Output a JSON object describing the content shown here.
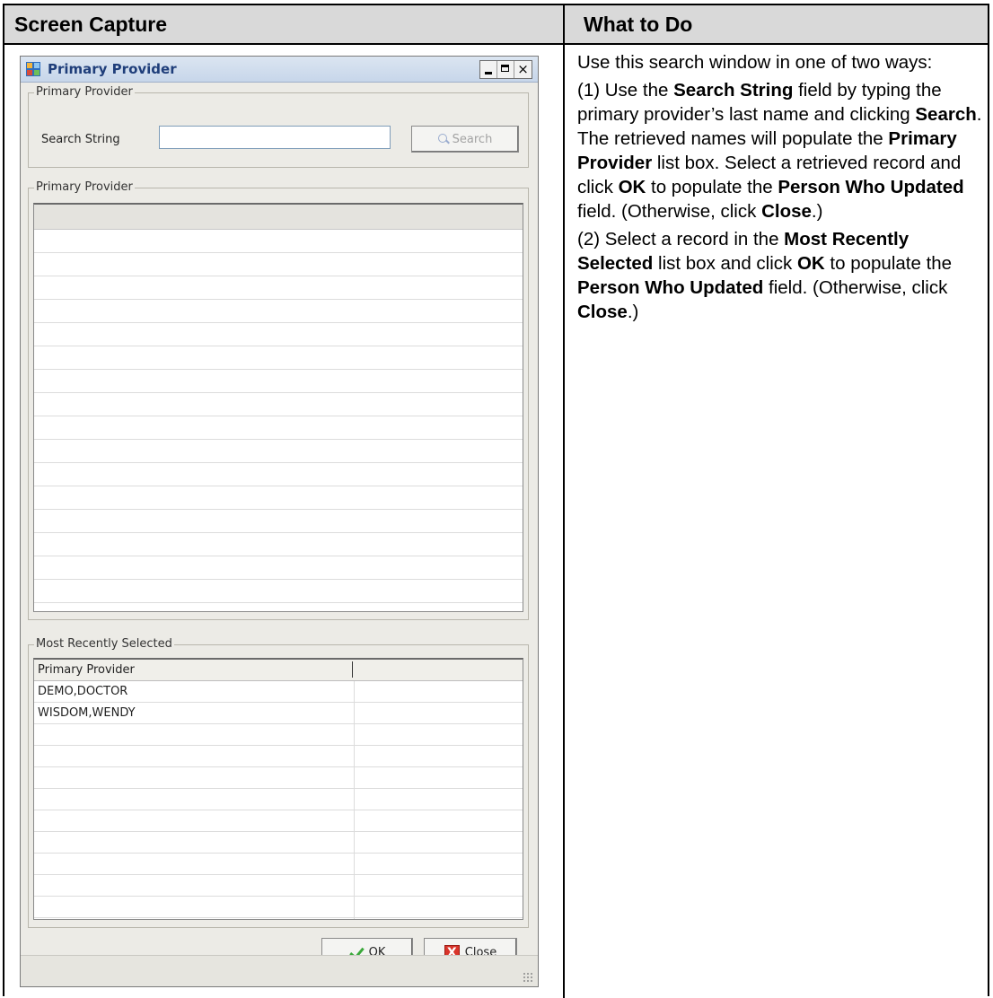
{
  "table": {
    "header_left": "Screen Capture",
    "header_right": "What to Do"
  },
  "dialog": {
    "title": "Primary Provider",
    "group_search_label": "Primary Provider",
    "search_label": "Search String",
    "search_value": "",
    "search_button": "Search",
    "group_results_label": "Primary Provider",
    "group_recent_label": "Most Recently Selected",
    "recent_column_header": "Primary Provider",
    "recent_rows": [
      "DEMO,DOCTOR",
      "WISDOM,WENDY"
    ],
    "ok_label": "OK",
    "close_label": "Close",
    "close_button_glyph": "×",
    "close_icon_glyph": "X"
  },
  "instructions": {
    "p1": "Use this search window in one of two ways:",
    "p2": {
      "t1": "(1) Use the ",
      "b1": "Search String",
      "t2": " field by typing the primary provider’s last name and clicking ",
      "b2": "Search",
      "t3": ". The retrieved names will populate the ",
      "b3": "Primary Provider",
      "t4": " list box. Select a retrieved record and click ",
      "b4": "OK",
      "t5": " to populate the ",
      "b5": "Person Who Updated",
      "t6": " field. (Otherwise, click ",
      "b6": "Close",
      "t7": ".)"
    },
    "p3": {
      "t1": "(2) Select a record in the ",
      "b1": "Most Recently Selected",
      "t2": " list box and click ",
      "b2": "OK",
      "t3": " to populate the ",
      "b3": "Person Who Updated",
      "t4": " field. (Otherwise, click ",
      "b4": "Close",
      "t5": ".)"
    }
  }
}
